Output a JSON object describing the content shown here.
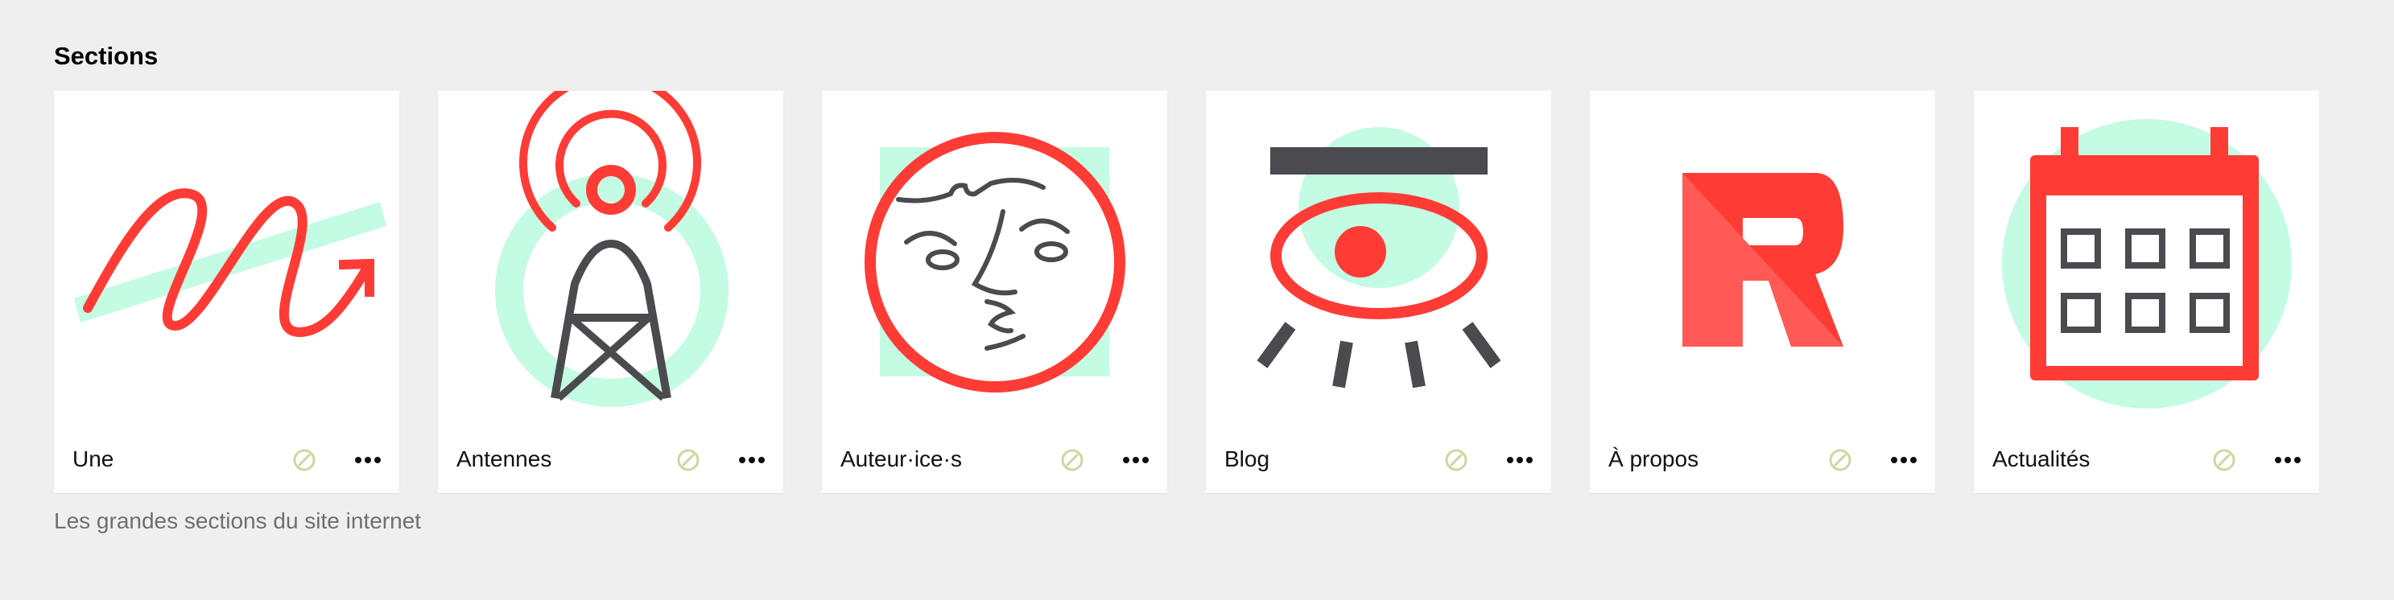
{
  "section": {
    "title": "Sections",
    "help_text": "Les grandes sections du site internet"
  },
  "cards": [
    {
      "label": "Une",
      "icon": "scribble-arrow-icon"
    },
    {
      "label": "Antennes",
      "icon": "antenna-tower-icon"
    },
    {
      "label": "Auteur·ice·s",
      "icon": "face-icon"
    },
    {
      "label": "Blog",
      "icon": "eye-icon"
    },
    {
      "label": "À propos",
      "icon": "r-logo-icon"
    },
    {
      "label": "Actualités",
      "icon": "calendar-icon"
    }
  ],
  "colors": {
    "red": "#ff3b36",
    "dark_gray": "#4a4a4f",
    "mint": "#c4fbe3",
    "status_icon": "#c9d9a0",
    "background": "#efefef"
  }
}
